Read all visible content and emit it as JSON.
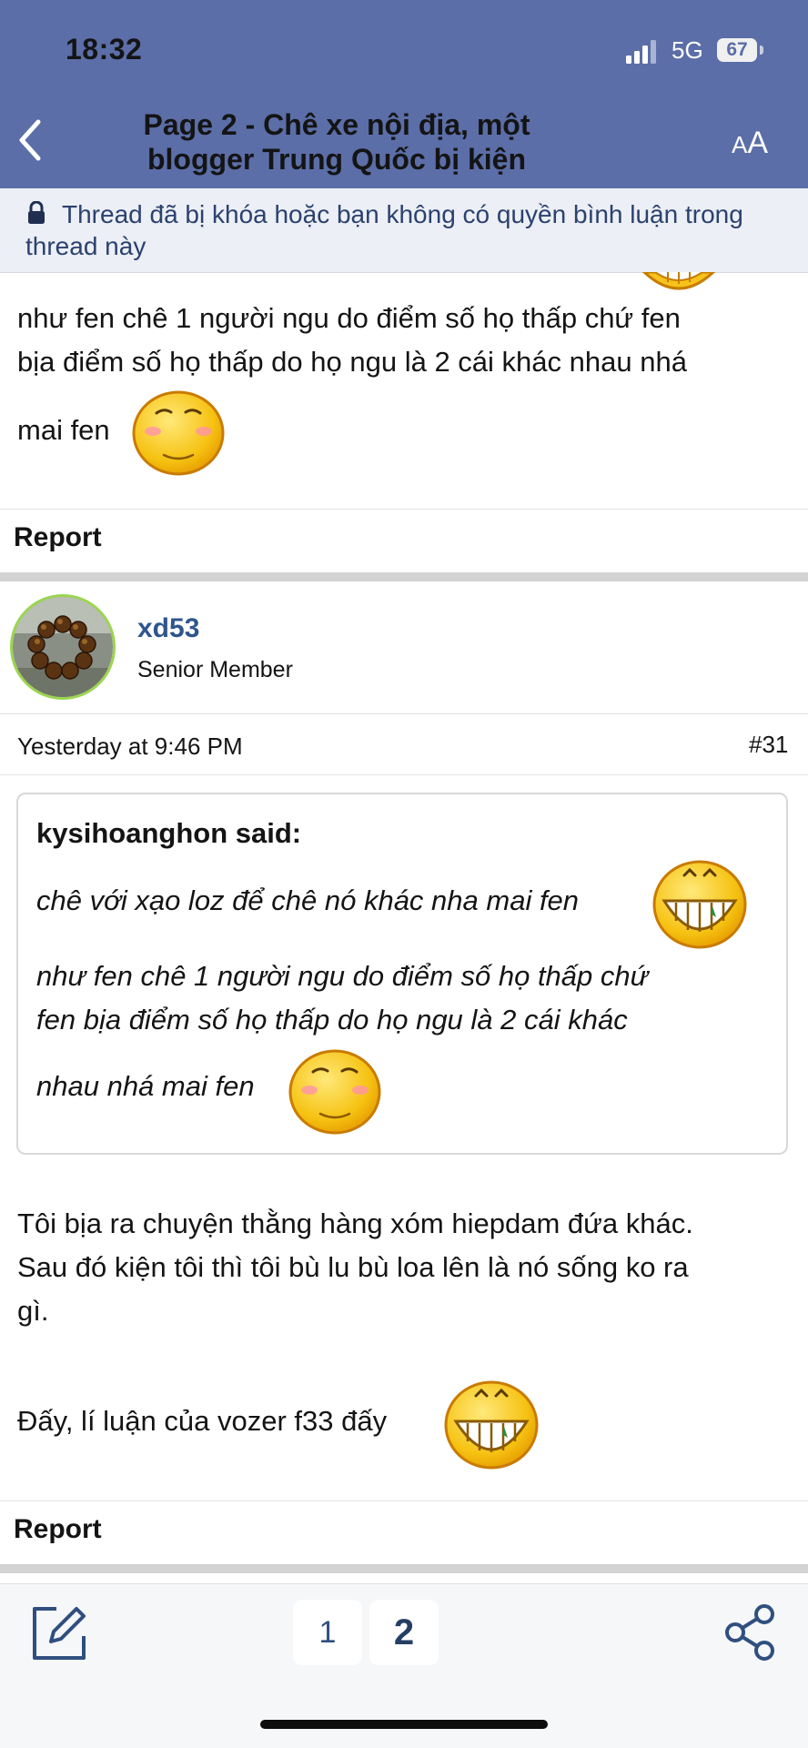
{
  "status_bar": {
    "time": "18:32",
    "network": "5G",
    "battery": "67"
  },
  "header": {
    "title": "Page 2 - Chê xe nội địa, một blogger Trung Quốc bị kiện",
    "font_size_label_small": "A",
    "font_size_label_large": "A"
  },
  "notice": {
    "text": "Thread đã bị khóa hoặc bạn không có quyền bình luận trong thread này"
  },
  "prev_post": {
    "line1": "như fen chê 1 người ngu do điểm số họ thấp chứ fen",
    "line2": "bịa điểm số họ thấp do họ ngu là 2 cái khác nhau nhá",
    "line3": "mai fen",
    "report": "Report"
  },
  "post": {
    "username": "xd53",
    "user_title": "Senior Member",
    "date": "Yesterday at 9:46 PM",
    "number": "#31",
    "quote": {
      "author": "kysihoanghon said:",
      "line1": "chê với xạo loz để chê nó khác nha mai fen",
      "line2": "như fen chê 1 người ngu do điểm số họ thấp chứ",
      "line3": "fen bịa điểm số họ thấp do họ ngu là 2 cái khác",
      "line4": "nhau nhá mai fen"
    },
    "body_line1": "Tôi bịa ra chuyện thằng hàng xóm hiepdam đứa khác.",
    "body_line2": "Sau đó kiện tôi thì tôi bù lu bù loa lên là nó sống ko ra",
    "body_line3": "gì.",
    "body_line4": "Đấy, lí luận của vozer f33 đấy",
    "report": "Report"
  },
  "pagination": {
    "page1": "1",
    "page2": "2",
    "current": "2"
  },
  "icons": [
    "back-arrow-icon",
    "lock-icon",
    "compose-icon",
    "share-icon",
    "grin-emoji",
    "blush-emoji"
  ],
  "colors": {
    "header_bg": "#5b6ea8",
    "notice_text": "#2b4170",
    "username": "#2f558c"
  }
}
